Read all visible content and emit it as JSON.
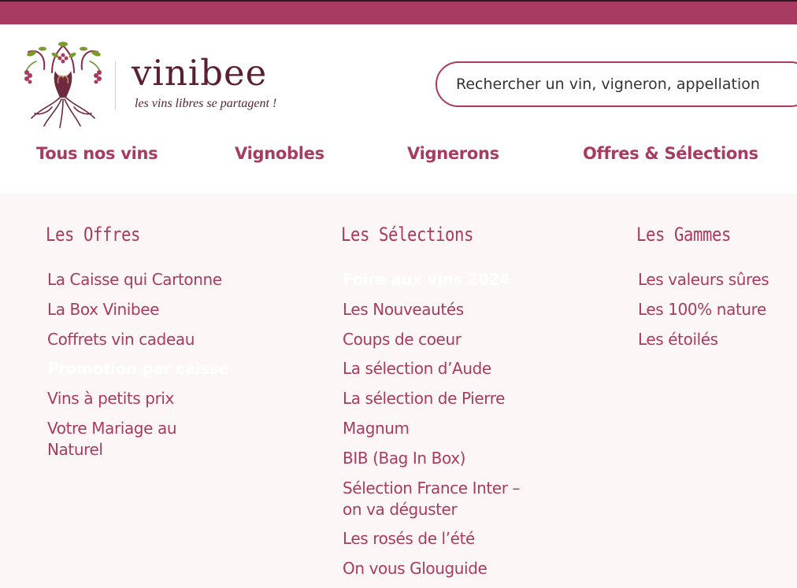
{
  "logo": {
    "name": "vinibee",
    "tagline": "les vins libres se partagent !",
    "icon": "grape-vine-tree-icon"
  },
  "search": {
    "placeholder": "Rechercher un vin, vigneron, appellation",
    "icon": "search-icon"
  },
  "nav": {
    "items": [
      "Tous nos vins",
      "Vignobles",
      "Vignerons",
      "Offres & Sélections"
    ]
  },
  "menu": {
    "offres": {
      "title": "Les Offres",
      "links": [
        "La Caisse qui Cartonne",
        "La Box Vinibee",
        "Coffrets vin cadeau",
        "Promotion par caisse",
        "Vins à petits prix",
        "Votre Mariage au Naturel"
      ],
      "highlighted": "Promotion par caisse"
    },
    "selections": {
      "title": "Les Sélections",
      "links": [
        "Foire aux vins 2024",
        "Les Nouveautés",
        "Coups de coeur",
        "La sélection d’Aude",
        "La sélection de Pierre",
        "Magnum",
        "BIB (Bag In Box)",
        "Sélection France Inter – on va déguster",
        "Les rosés de l’été",
        "On vous Glouguide"
      ],
      "highlighted": "Foire aux vins 2024"
    },
    "gammes": {
      "title": "Les Gammes",
      "links": [
        "Les valeurs sûres",
        "Les 100% nature",
        "Les étoilés"
      ]
    }
  },
  "colors": {
    "brand": "#a93a62",
    "menu_background": "#fcf7f6",
    "logo_text": "#5a1f33"
  }
}
